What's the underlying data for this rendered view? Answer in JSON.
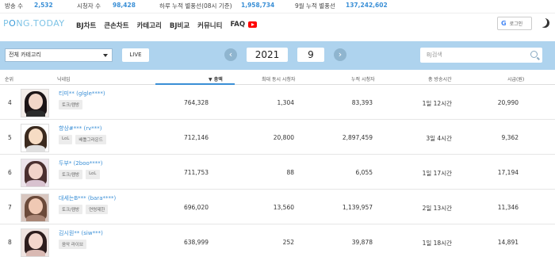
{
  "stats": {
    "broadcasts_label": "방송 수",
    "broadcasts_value": "2,532",
    "viewers_label": "시청자 수",
    "viewers_value": "98,428",
    "daily_balloons_label": "하루 누적 별풍선(08시 기준)",
    "daily_balloons_value": "1,958,734",
    "monthly_balloons_label": "9월 누적 별풍선",
    "monthly_balloons_value": "137,242,602"
  },
  "header": {
    "logo_a": "P",
    "logo_b": "NG.TODAY",
    "logo_mid": "O",
    "nav": [
      "BJ차트",
      "큰손차트",
      "카테고리",
      "BJ비교",
      "커뮤니티",
      "FAQ"
    ],
    "login_icon": "G",
    "login_label": "로그인"
  },
  "filters": {
    "category": "전체 카테고리",
    "live_label": "LIVE",
    "prev_arrow": "‹",
    "next_arrow": "›",
    "year": "2021",
    "month": "9",
    "search_placeholder": "BJ검색"
  },
  "table": {
    "headers": [
      "순위",
      "닉네임",
      "▼ 총액",
      "최대 동시 시청자",
      "누적 시청자",
      "총 방송시간",
      "시급(원)"
    ],
    "rows": [
      {
        "rank": "4",
        "nick": "티미** (glgle****)",
        "tags": [
          "토크/캠방"
        ],
        "total": "764,328",
        "max_viewers": "1,304",
        "cum_viewers": "83,393",
        "time": "1일 12시간",
        "hourly": "20,990",
        "avatar_bg": "#f3ece8",
        "hair": "#1c1416",
        "face": "#f2d6c8",
        "body": "#2b2b2b"
      },
      {
        "rank": "5",
        "nick": "향상#*** (rv***)",
        "tags": [
          "LoL",
          "배틀그라운드"
        ],
        "total": "712,146",
        "max_viewers": "20,800",
        "cum_viewers": "2,897,459",
        "time": "3일 4시간",
        "hourly": "9,362",
        "avatar_bg": "#ffffff",
        "hair": "#3b2a1e",
        "face": "#f6dcc4",
        "body": "#e0e0e0"
      },
      {
        "rank": "6",
        "nick": "두부* (2boo****)",
        "tags": [
          "토크/캠방",
          "LoL"
        ],
        "total": "711,753",
        "max_viewers": "88",
        "cum_viewers": "6,055",
        "time": "1일 17시간",
        "hourly": "17,194",
        "avatar_bg": "#ece3ea",
        "hair": "#4a2f2f",
        "face": "#f1d3c9",
        "body": "#d8c2cf"
      },
      {
        "rank": "7",
        "nick": "대세는B*** (bara****)",
        "tags": [
          "토크/캠방",
          "연령제한"
        ],
        "total": "696,020",
        "max_viewers": "13,560",
        "cum_viewers": "1,139,957",
        "time": "2일 13시간",
        "hourly": "11,346",
        "avatar_bg": "#d8c6bf",
        "hair": "#6b4a3a",
        "face": "#f0c9b4",
        "body": "#a88474"
      },
      {
        "rank": "8",
        "nick": "김시원** (siw***)",
        "tags": [
          "음악 라이브"
        ],
        "total": "638,999",
        "max_viewers": "252",
        "cum_viewers": "39,878",
        "time": "1일 18시간",
        "hourly": "14,891",
        "avatar_bg": "#efe3e0",
        "hair": "#2d1d1d",
        "face": "#f3d6cc",
        "body": "#d9b9b3"
      }
    ]
  },
  "colors": {
    "accent": "#3a8fd6",
    "band": "#aed3ee"
  }
}
